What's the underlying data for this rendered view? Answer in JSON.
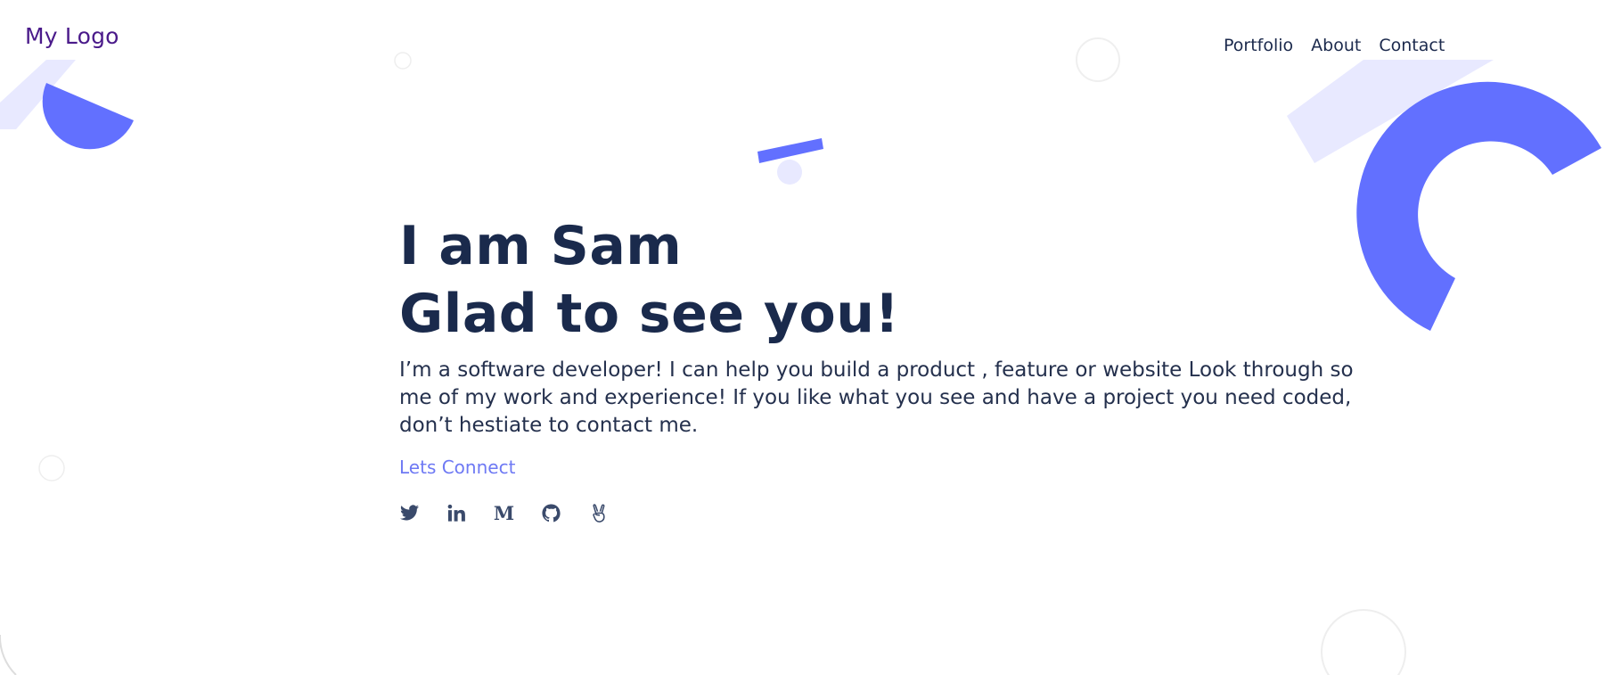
{
  "header": {
    "logo": "My Logo",
    "nav": [
      {
        "label": "Portfolio"
      },
      {
        "label": "About"
      },
      {
        "label": "Contact"
      }
    ]
  },
  "hero": {
    "title_line1": "I am Sam",
    "title_line2": "Glad to see you!",
    "intro": "I’m a software developer! I can help you build a product , feature or website Look through some of my work and experience! If you like what you see and have a project you need coded, don’t hestiate to contact me.",
    "cta": "Lets Connect",
    "socials": [
      {
        "icon": "twitter-icon"
      },
      {
        "icon": "linkedin-icon"
      },
      {
        "icon": "medium-icon",
        "glyph": "M"
      },
      {
        "icon": "github-icon"
      },
      {
        "icon": "angellist-icon"
      }
    ]
  },
  "colors": {
    "logo": "#4a1a8a",
    "heading": "#1a2a4c",
    "text": "#24304d",
    "accent": "#6e79f4",
    "shape_primary": "#6270ff",
    "shape_light": "#e8e9ff"
  }
}
